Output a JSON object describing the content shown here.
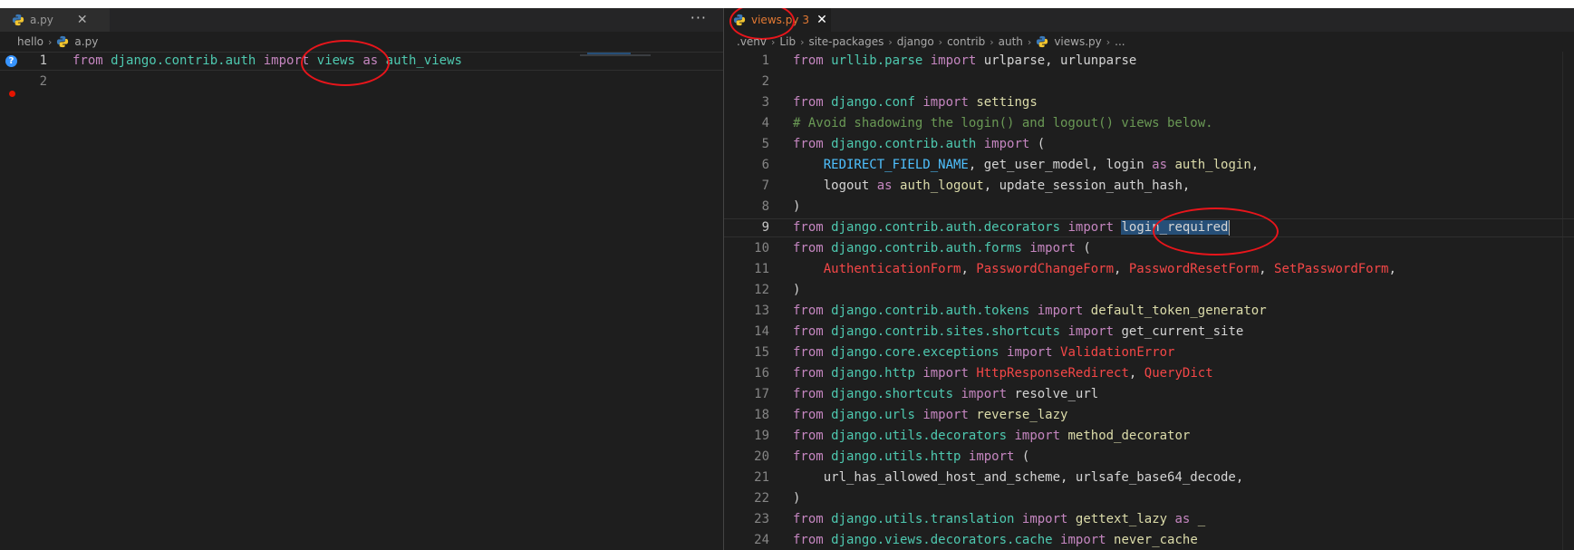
{
  "colors": {
    "background": "#1e1e1e",
    "keyword": "#c586c0",
    "module": "#4ec9b0",
    "function": "#dcdcaa",
    "constant": "#4fc1ff",
    "error": "#f44747",
    "comment": "#6a9955",
    "annotation": "#e8151b"
  },
  "left": {
    "tab": {
      "label": "a.py",
      "icon": "python-icon",
      "close": "✕"
    },
    "more_actions": "···",
    "breadcrumb": {
      "folder": "hello",
      "sep": "›",
      "file": "a.py"
    },
    "lines": [
      {
        "n": "1",
        "tokens": [
          {
            "t": "from",
            "c": "kw"
          },
          {
            "t": " "
          },
          {
            "t": "django.contrib.auth",
            "c": "mod"
          },
          {
            "t": " "
          },
          {
            "t": "import",
            "c": "kw"
          },
          {
            "t": " "
          },
          {
            "t": "views",
            "c": "mod"
          },
          {
            "t": " "
          },
          {
            "t": "as",
            "c": "kw"
          },
          {
            "t": " "
          },
          {
            "t": "auth_views",
            "c": "mod"
          }
        ]
      },
      {
        "n": "2",
        "tokens": []
      }
    ],
    "gutter_glyph_1": "?"
  },
  "right": {
    "tab": {
      "label": "views.py",
      "badge": "3",
      "icon": "python-icon",
      "close": "✕"
    },
    "breadcrumb": [
      ".venv",
      "Lib",
      "site-packages",
      "django",
      "contrib",
      "auth",
      "views.py",
      "..."
    ],
    "lines": [
      {
        "n": "1",
        "tokens": [
          {
            "t": "from",
            "c": "kw"
          },
          {
            "t": " "
          },
          {
            "t": "urllib.parse",
            "c": "mod"
          },
          {
            "t": " "
          },
          {
            "t": "import",
            "c": "kw"
          },
          {
            "t": " urlparse, urlunparse"
          }
        ]
      },
      {
        "n": "2",
        "tokens": []
      },
      {
        "n": "3",
        "tokens": [
          {
            "t": "from",
            "c": "kw"
          },
          {
            "t": " "
          },
          {
            "t": "django.conf",
            "c": "mod"
          },
          {
            "t": " "
          },
          {
            "t": "import",
            "c": "kw"
          },
          {
            "t": " "
          },
          {
            "t": "settings",
            "c": "fn"
          }
        ]
      },
      {
        "n": "4",
        "tokens": [
          {
            "t": "# Avoid shadowing the login() and logout() views below.",
            "c": "cm"
          }
        ]
      },
      {
        "n": "5",
        "tokens": [
          {
            "t": "from",
            "c": "kw"
          },
          {
            "t": " "
          },
          {
            "t": "django.contrib.auth",
            "c": "mod"
          },
          {
            "t": " "
          },
          {
            "t": "import",
            "c": "kw"
          },
          {
            "t": " ("
          }
        ]
      },
      {
        "n": "6",
        "tokens": [
          {
            "t": "    "
          },
          {
            "t": "REDIRECT_FIELD_NAME",
            "c": "const"
          },
          {
            "t": ", get_user_model, login "
          },
          {
            "t": "as",
            "c": "kw"
          },
          {
            "t": " "
          },
          {
            "t": "auth_login",
            "c": "fn"
          },
          {
            "t": ","
          }
        ]
      },
      {
        "n": "7",
        "tokens": [
          {
            "t": "    logout "
          },
          {
            "t": "as",
            "c": "kw"
          },
          {
            "t": " "
          },
          {
            "t": "auth_logout",
            "c": "fn"
          },
          {
            "t": ", update_session_auth_hash,"
          }
        ]
      },
      {
        "n": "8",
        "tokens": [
          {
            "t": ")"
          }
        ]
      },
      {
        "n": "9",
        "tokens": [
          {
            "t": "from",
            "c": "kw"
          },
          {
            "t": " "
          },
          {
            "t": "django.contrib.auth.decorators",
            "c": "mod"
          },
          {
            "t": " "
          },
          {
            "t": "import",
            "c": "kw"
          },
          {
            "t": " "
          },
          {
            "t": "login_required",
            "c": "sel"
          },
          {
            "cursor": true
          }
        ]
      },
      {
        "n": "10",
        "tokens": [
          {
            "t": "from",
            "c": "kw"
          },
          {
            "t": " "
          },
          {
            "t": "django.contrib.auth.forms",
            "c": "mod"
          },
          {
            "t": " "
          },
          {
            "t": "import",
            "c": "kw"
          },
          {
            "t": " ("
          }
        ]
      },
      {
        "n": "11",
        "tokens": [
          {
            "t": "    "
          },
          {
            "t": "AuthenticationForm",
            "c": "err"
          },
          {
            "t": ", "
          },
          {
            "t": "PasswordChangeForm",
            "c": "err"
          },
          {
            "t": ", "
          },
          {
            "t": "PasswordResetForm",
            "c": "err"
          },
          {
            "t": ", "
          },
          {
            "t": "SetPasswordForm",
            "c": "err"
          },
          {
            "t": ","
          }
        ]
      },
      {
        "n": "12",
        "tokens": [
          {
            "t": ")"
          }
        ]
      },
      {
        "n": "13",
        "tokens": [
          {
            "t": "from",
            "c": "kw"
          },
          {
            "t": " "
          },
          {
            "t": "django.contrib.auth.tokens",
            "c": "mod"
          },
          {
            "t": " "
          },
          {
            "t": "import",
            "c": "kw"
          },
          {
            "t": " "
          },
          {
            "t": "default_token_generator",
            "c": "fn"
          }
        ]
      },
      {
        "n": "14",
        "tokens": [
          {
            "t": "from",
            "c": "kw"
          },
          {
            "t": " "
          },
          {
            "t": "django.contrib.sites.shortcuts",
            "c": "mod"
          },
          {
            "t": " "
          },
          {
            "t": "import",
            "c": "kw"
          },
          {
            "t": " get_current_site"
          }
        ]
      },
      {
        "n": "15",
        "tokens": [
          {
            "t": "from",
            "c": "kw"
          },
          {
            "t": " "
          },
          {
            "t": "django.core.exceptions",
            "c": "mod"
          },
          {
            "t": " "
          },
          {
            "t": "import",
            "c": "kw"
          },
          {
            "t": " "
          },
          {
            "t": "ValidationError",
            "c": "err"
          }
        ]
      },
      {
        "n": "16",
        "tokens": [
          {
            "t": "from",
            "c": "kw"
          },
          {
            "t": " "
          },
          {
            "t": "django.http",
            "c": "mod"
          },
          {
            "t": " "
          },
          {
            "t": "import",
            "c": "kw"
          },
          {
            "t": " "
          },
          {
            "t": "HttpResponseRedirect",
            "c": "err"
          },
          {
            "t": ", "
          },
          {
            "t": "QueryDict",
            "c": "err"
          }
        ]
      },
      {
        "n": "17",
        "tokens": [
          {
            "t": "from",
            "c": "kw"
          },
          {
            "t": " "
          },
          {
            "t": "django.shortcuts",
            "c": "mod"
          },
          {
            "t": " "
          },
          {
            "t": "import",
            "c": "kw"
          },
          {
            "t": " resolve_url"
          }
        ]
      },
      {
        "n": "18",
        "tokens": [
          {
            "t": "from",
            "c": "kw"
          },
          {
            "t": " "
          },
          {
            "t": "django.urls",
            "c": "mod"
          },
          {
            "t": " "
          },
          {
            "t": "import",
            "c": "kw"
          },
          {
            "t": " "
          },
          {
            "t": "reverse_lazy",
            "c": "fn"
          }
        ]
      },
      {
        "n": "19",
        "tokens": [
          {
            "t": "from",
            "c": "kw"
          },
          {
            "t": " "
          },
          {
            "t": "django.utils.decorators",
            "c": "mod"
          },
          {
            "t": " "
          },
          {
            "t": "import",
            "c": "kw"
          },
          {
            "t": " "
          },
          {
            "t": "method_decorator",
            "c": "fn"
          }
        ]
      },
      {
        "n": "20",
        "tokens": [
          {
            "t": "from",
            "c": "kw"
          },
          {
            "t": " "
          },
          {
            "t": "django.utils.http",
            "c": "mod"
          },
          {
            "t": " "
          },
          {
            "t": "import",
            "c": "kw"
          },
          {
            "t": " ("
          }
        ]
      },
      {
        "n": "21",
        "tokens": [
          {
            "t": "    url_has_allowed_host_and_scheme, urlsafe_base64_decode,"
          }
        ]
      },
      {
        "n": "22",
        "tokens": [
          {
            "t": ")"
          }
        ]
      },
      {
        "n": "23",
        "tokens": [
          {
            "t": "from",
            "c": "kw"
          },
          {
            "t": " "
          },
          {
            "t": "django.utils.translation",
            "c": "mod"
          },
          {
            "t": " "
          },
          {
            "t": "import",
            "c": "kw"
          },
          {
            "t": " "
          },
          {
            "t": "gettext_lazy",
            "c": "fn"
          },
          {
            "t": " "
          },
          {
            "t": "as",
            "c": "kw"
          },
          {
            "t": " "
          },
          {
            "t": "_",
            "c": "fn"
          }
        ]
      },
      {
        "n": "24",
        "tokens": [
          {
            "t": "from",
            "c": "kw"
          },
          {
            "t": " "
          },
          {
            "t": "django.views.decorators.cache",
            "c": "mod"
          },
          {
            "t": " "
          },
          {
            "t": "import",
            "c": "kw"
          },
          {
            "t": " "
          },
          {
            "t": "never_cache",
            "c": "fn"
          }
        ]
      }
    ]
  }
}
